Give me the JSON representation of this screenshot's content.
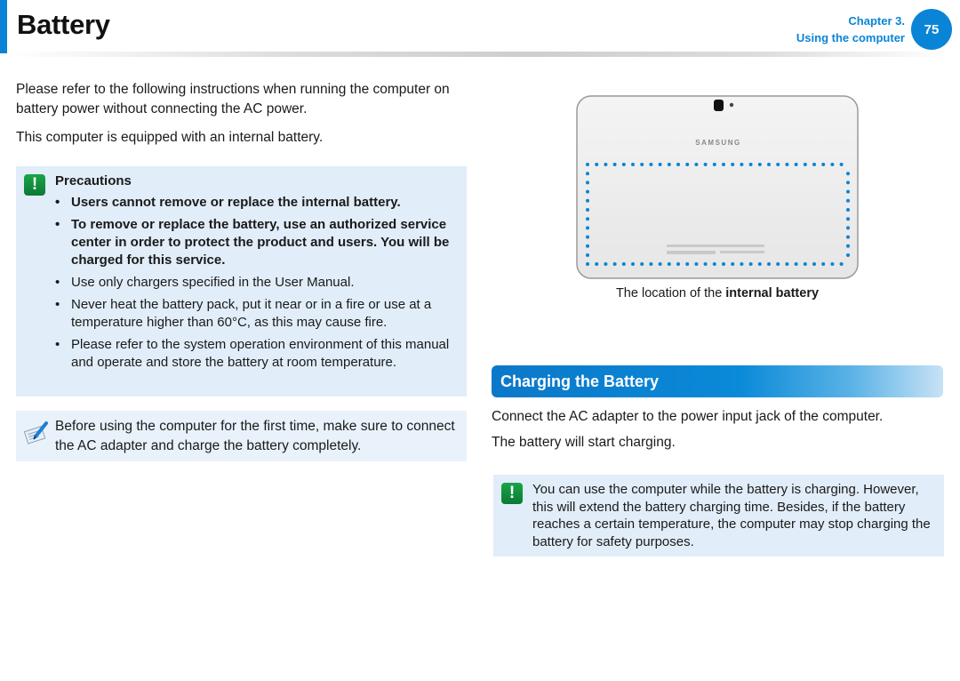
{
  "header": {
    "title": "Battery",
    "chapter_label": "Chapter 3.",
    "chapter_name": "Using the computer",
    "page_number": "75",
    "accent_color": "#0a84d6"
  },
  "intro": {
    "paragraph1": "Please refer to the following instructions when running the computer on battery power without connecting the AC power.",
    "paragraph2": "This computer is equipped with an internal battery."
  },
  "precautions": {
    "icon": "warning-exclamation-icon",
    "title": "Precautions",
    "items": [
      {
        "text": "Users cannot remove or replace the internal battery.",
        "bold": true
      },
      {
        "text": "To remove or replace the battery, use an authorized service center in order to protect the product and users. You will be charged for this service.",
        "bold": true
      },
      {
        "text": "Use only chargers specified in the User Manual.",
        "bold": false
      },
      {
        "text": "Never heat the battery pack, put it near or in a fire or use at a temperature higher than 60°C, as this may cause fire.",
        "bold": false
      },
      {
        "text": "Please refer to the system operation environment of this manual and operate and store the battery at room temperature.",
        "bold": false
      }
    ]
  },
  "note": {
    "icon": "note-pencil-icon",
    "text": "Before using the computer for the first time, make sure to connect the AC adapter and charge the battery completely."
  },
  "figure": {
    "brand": "SAMSUNG",
    "caption_prefix": "The location of the ",
    "caption_bold": "internal battery",
    "highlight_color": "#0a84d6"
  },
  "charging": {
    "section_title": "Charging the Battery",
    "paragraph1": "Connect the AC adapter to the power input jack of the computer.",
    "paragraph2": "The battery will start charging.",
    "tip_icon": "warning-exclamation-icon",
    "tip_text": "You can use the computer while the battery is charging. However, this will extend the battery charging time. Besides, if the battery reaches a certain temperature, the computer may stop charging the battery for safety purposes."
  }
}
